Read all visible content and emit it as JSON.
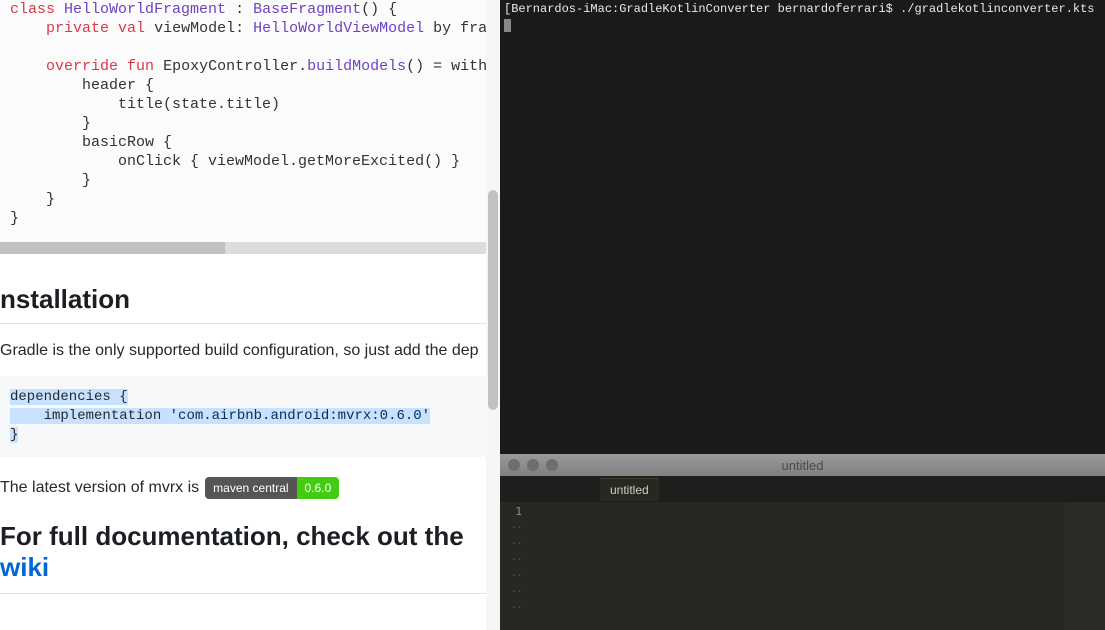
{
  "code": {
    "l1a": "class",
    "l1b": "HelloWorldFragment",
    "l1c": " : ",
    "l1d": "BaseFragment",
    "l1e": "() {",
    "l2a": "    ",
    "l2b": "private",
    "l2c": " ",
    "l2d": "val",
    "l2e": " viewModel: ",
    "l2f": "HelloWorldViewModel",
    "l2g": " by fragment",
    "l3": "",
    "l4a": "    ",
    "l4b": "override",
    "l4c": " ",
    "l4d": "fun",
    "l4e": " EpoxyController.",
    "l4f": "buildModels",
    "l4g": "() = withState",
    "l5": "        header {",
    "l6": "            title(state.title)",
    "l7": "        }",
    "l8": "        basicRow {",
    "l9": "            onClick { viewModel.getMoreExcited() }",
    "l10": "        }",
    "l11": "    }",
    "l12": "}"
  },
  "sections": {
    "installation_heading": "nstallation",
    "installation_text": "Gradle is the only supported build configuration, so just add the dep",
    "dep_open": "dependencies {",
    "dep_inner_pre": "    implementation ",
    "dep_inner_str": "'com.airbnb.android:mvrx:0.6.0'",
    "dep_close": "}",
    "latest_text": "The latest version of mvrx is",
    "badge_left": "maven central",
    "badge_right": "0.6.0",
    "doc_heading_pre": "For full documentation, check out the ",
    "doc_heading_link": "wiki"
  },
  "terminal": {
    "line1": "[Bernardos-iMac:GradleKotlinConverter bernardoferrari$ ./gradlekotlinconverter.kts"
  },
  "editor": {
    "window_title": "untitled",
    "tab_title": "untitled",
    "line_number": "1"
  }
}
